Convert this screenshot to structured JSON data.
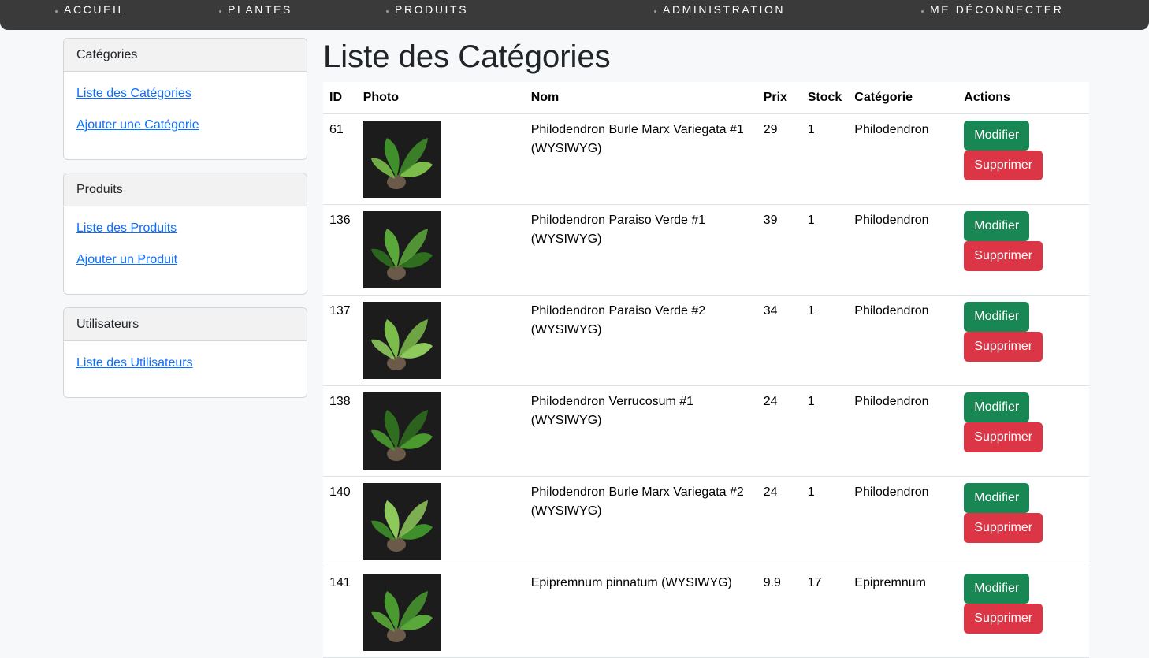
{
  "nav": {
    "items": [
      {
        "label": "ACCUEIL"
      },
      {
        "label": "PLANTES"
      },
      {
        "label": "PRODUITS"
      },
      {
        "label": "ADMINISTRATION"
      },
      {
        "label": "ME DÉCONNECTER"
      }
    ]
  },
  "sidebar": {
    "categories": {
      "title": "Catégories",
      "links": [
        "Liste des Catégories",
        "Ajouter une Catégorie"
      ]
    },
    "produits": {
      "title": "Produits",
      "links": [
        "Liste des Produits",
        "Ajouter un Produit"
      ]
    },
    "utilisateurs": {
      "title": "Utilisateurs",
      "links": [
        "Liste des Utilisateurs"
      ]
    }
  },
  "main": {
    "title": "Liste des Catégories",
    "columns": [
      "ID",
      "Photo",
      "Nom",
      "Prix",
      "Stock",
      "Catégorie",
      "Actions"
    ],
    "modify_label": "Modifier",
    "delete_label": "Supprimer",
    "rows": [
      {
        "id": "61",
        "name": "Philodendron Burle Marx Variegata #1 (WYSIWYG)",
        "price": "29",
        "stock": "1",
        "category": "Philodendron"
      },
      {
        "id": "136",
        "name": "Philodendron Paraiso Verde #1 (WYSIWYG)",
        "price": "39",
        "stock": "1",
        "category": "Philodendron"
      },
      {
        "id": "137",
        "name": "Philodendron Paraiso Verde #2 (WYSIWYG)",
        "price": "34",
        "stock": "1",
        "category": "Philodendron"
      },
      {
        "id": "138",
        "name": "Philodendron Verrucosum #1 (WYSIWYG)",
        "price": "24",
        "stock": "1",
        "category": "Philodendron"
      },
      {
        "id": "140",
        "name": "Philodendron Burle Marx Variegata #2 (WYSIWYG)",
        "price": "24",
        "stock": "1",
        "category": "Philodendron"
      },
      {
        "id": "141",
        "name": "Epipremnum pinnatum (WYSIWYG)",
        "price": "9.9",
        "stock": "17",
        "category": "Epipremnum"
      }
    ]
  },
  "colors": {
    "nav_bg": "#3a3a3a",
    "link": "#0d6efd",
    "modify_btn": "#198754",
    "delete_btn": "#dc3545"
  }
}
